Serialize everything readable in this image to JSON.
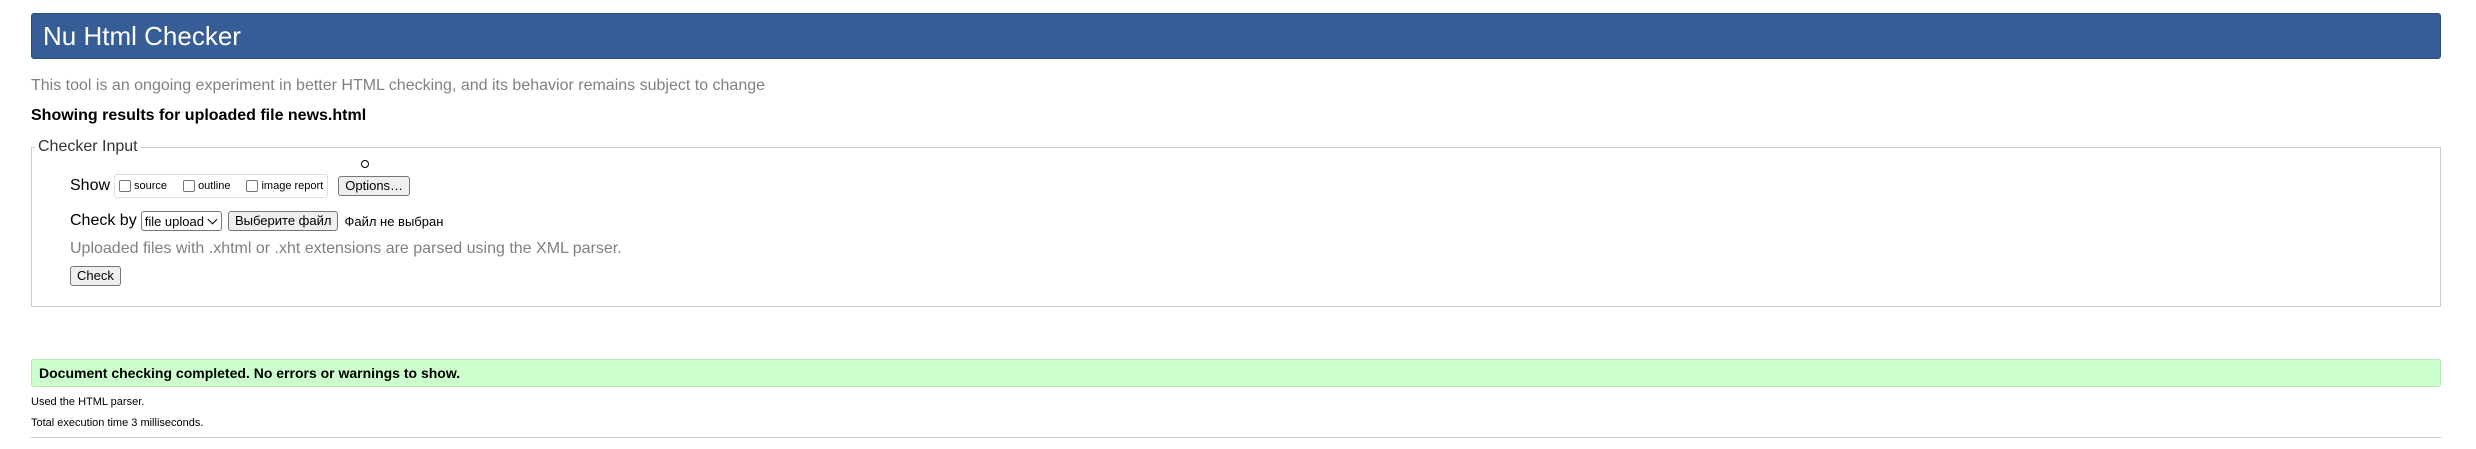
{
  "header": {
    "title": "Nu Html Checker",
    "background": "#365d95"
  },
  "intro": "This tool is an ongoing experiment in better HTML checking, and its behavior remains subject to change",
  "results_heading": "Showing results for uploaded file news.html",
  "checker_input": {
    "legend": "Checker Input",
    "show_label": "Show",
    "show_options": [
      {
        "label": "source",
        "checked": false
      },
      {
        "label": "outline",
        "checked": false
      },
      {
        "label": "image report",
        "checked": false
      }
    ],
    "options_button": "Options…",
    "check_by_label": "Check by",
    "check_by_selected": "file upload",
    "file_button": "Выберите файл",
    "file_status": "Файл не выбран",
    "parser_note": "Uploaded files with .xhtml or .xht extensions are parsed using the XML parser.",
    "check_button": "Check"
  },
  "result": {
    "message": "Document checking completed. No errors or warnings to show.",
    "background": "#ccffcc"
  },
  "footer": {
    "used_parser": "Used the HTML parser.",
    "execution_time": "Total execution time 3 milliseconds."
  }
}
